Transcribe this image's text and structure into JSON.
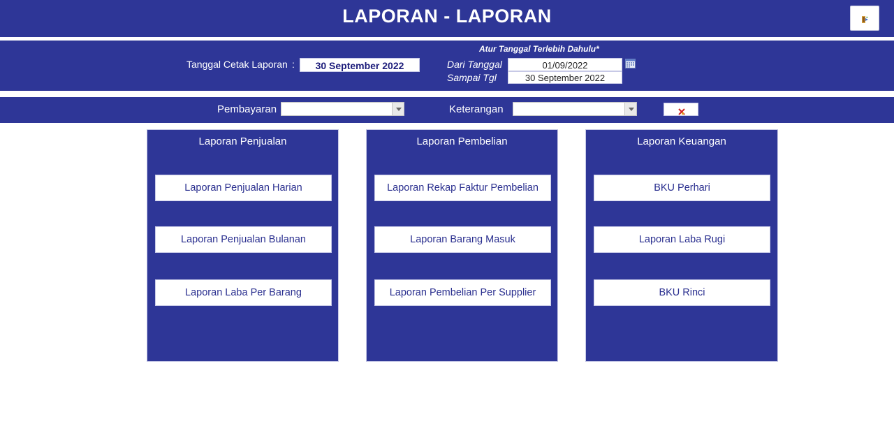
{
  "header": {
    "title": "LAPORAN - LAPORAN",
    "exit_icon": "exit-door-icon"
  },
  "print_date": {
    "label": "Tanggal Cetak Laporan",
    "colon": ":",
    "value": "30 September 2022"
  },
  "date_range": {
    "note": "Atur Tanggal Terlebih Dahulu*",
    "from_label": "Dari Tanggal",
    "from_value": "01/09/2022",
    "to_label": "Sampai Tgl",
    "to_value": "30 September 2022",
    "calendar_icon": "calendar-icon"
  },
  "filters": {
    "payment_label": "Pembayaran",
    "payment_value": "",
    "note_label": "Keterangan",
    "note_value": "",
    "clear_icon": "clear-filter-icon"
  },
  "panels": [
    {
      "title": "Laporan Penjualan",
      "buttons": [
        "Laporan Penjualan Harian",
        "Laporan Penjualan Bulanan",
        "Laporan Laba Per Barang"
      ]
    },
    {
      "title": "Laporan Pembelian",
      "buttons": [
        "Laporan Rekap Faktur Pembelian",
        "Laporan Barang Masuk",
        "Laporan Pembelian Per Supplier"
      ]
    },
    {
      "title": "Laporan Keuangan",
      "buttons": [
        "BKU Perhari",
        "Laporan Laba Rugi",
        "BKU Rinci"
      ]
    }
  ],
  "colors": {
    "primary": "#2e3697",
    "text_dark": "#1b1b7a",
    "background": "#ffffff"
  }
}
